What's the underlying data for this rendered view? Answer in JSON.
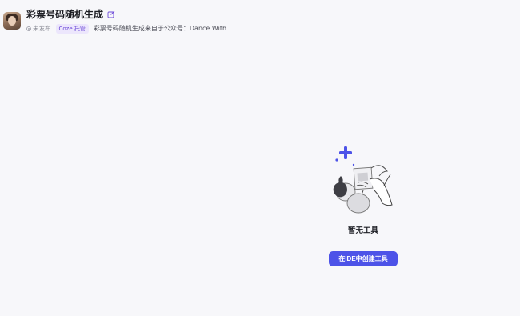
{
  "header": {
    "title": "彩票号码随机生成",
    "status": "未发布",
    "badge": "Coze 托管",
    "description": "彩票号码随机生成来自于公众号：Dance With ..."
  },
  "empty_state": {
    "title": "暂无工具",
    "button_label": "在IDE中创建工具"
  },
  "colors": {
    "accent": "#4d53e8",
    "badge_text": "#6e4bd8",
    "badge_bg": "#ece6fc",
    "background": "#f7f7fa"
  }
}
